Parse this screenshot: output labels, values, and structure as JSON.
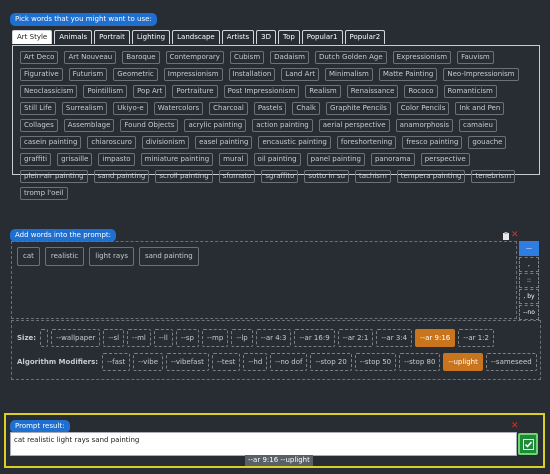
{
  "header": {
    "pick_label": "Pick words that you might want to use:"
  },
  "tabs": [
    {
      "label": "Art Style",
      "active": true
    },
    {
      "label": "Animals"
    },
    {
      "label": "Portrait"
    },
    {
      "label": "Lighting"
    },
    {
      "label": "Landscape"
    },
    {
      "label": "Artists"
    },
    {
      "label": "3D"
    },
    {
      "label": "Top"
    },
    {
      "label": "Popular1"
    },
    {
      "label": "Popular2"
    }
  ],
  "art_style_words": [
    "Art Deco",
    "Art Nouveau",
    "Baroque",
    "Contemporary",
    "Cubism",
    "Dadaism",
    "Dutch Golden Age",
    "Expressionism",
    "Fauvism",
    "Figurative",
    "Futurism",
    "Geometric",
    "Impressionism",
    "Installation",
    "Land Art",
    "Minimalism",
    "Matte Painting",
    "Neo-Impressionism",
    "Neoclassicism",
    "Pointillism",
    "Pop Art",
    "Portraiture",
    "Post Impressionism",
    "Realism",
    "Renaissance",
    "Rococo",
    "Romanticism",
    "Still Life",
    "Surrealism",
    "Ukiyo-e",
    "Watercolors",
    "Charcoal",
    "Pastels",
    "Chalk",
    "Graphite Pencils",
    "Color Pencils",
    "Ink and Pen",
    "Collages",
    "Assemblage",
    "Found Objects",
    "acrylic painting",
    "action painting",
    "aerial perspective",
    "anamorphosis",
    "camaieu",
    "casein painting",
    "chiaroscuro",
    "divisionism",
    "easel painting",
    "encaustic painting",
    "foreshortening",
    "fresco painting",
    "gouache",
    "graffiti",
    "grisaille",
    "impasto",
    "miniature painting",
    "mural",
    "oil painting",
    "panel painting",
    "panorama",
    "perspective",
    "plein-air painting",
    "sand painting",
    "scroll painting",
    "sfumato",
    "sgraffito",
    "sotto in su",
    "tachism",
    "tempera painting",
    "tenebrism",
    "tromp l'oeil"
  ],
  "add_words": {
    "label": "Add words into the prompt:",
    "chips": [
      "cat",
      "realistic",
      "light rays",
      "sand painting"
    ]
  },
  "side_buttons": [
    "—",
    ",",
    "::",
    ", by",
    "--no"
  ],
  "size": {
    "label": "Size:",
    "options": [
      "",
      "--wallpaper",
      "--sl",
      "--ml",
      "--ll",
      "--sp",
      "--mp",
      "--lp",
      "--ar 4:3",
      "--ar 16:9",
      "--ar 2:1",
      "--ar 3:4",
      "--ar 9:16",
      "--ar 1:2"
    ],
    "selected": "--ar 9:16"
  },
  "modifiers": {
    "label": "Algorithm Modifiers:",
    "options": [
      "--fast",
      "--vibe",
      "--vibefast",
      "--test",
      "--hd",
      "--no dof",
      "--stop 20",
      "--stop 50",
      "--stop 80",
      "--uplight",
      "--sameseed"
    ],
    "selected": "--uplight"
  },
  "result": {
    "label": "Prompt result:",
    "text": "cat realistic light rays sand painting",
    "suffix": "--ar 9:16 --uplight"
  },
  "colors": {
    "accent": "#1f6fd0",
    "selected": "#c8751e",
    "result_border": "#d9cf27",
    "copy_button": "#1f8a3a"
  }
}
